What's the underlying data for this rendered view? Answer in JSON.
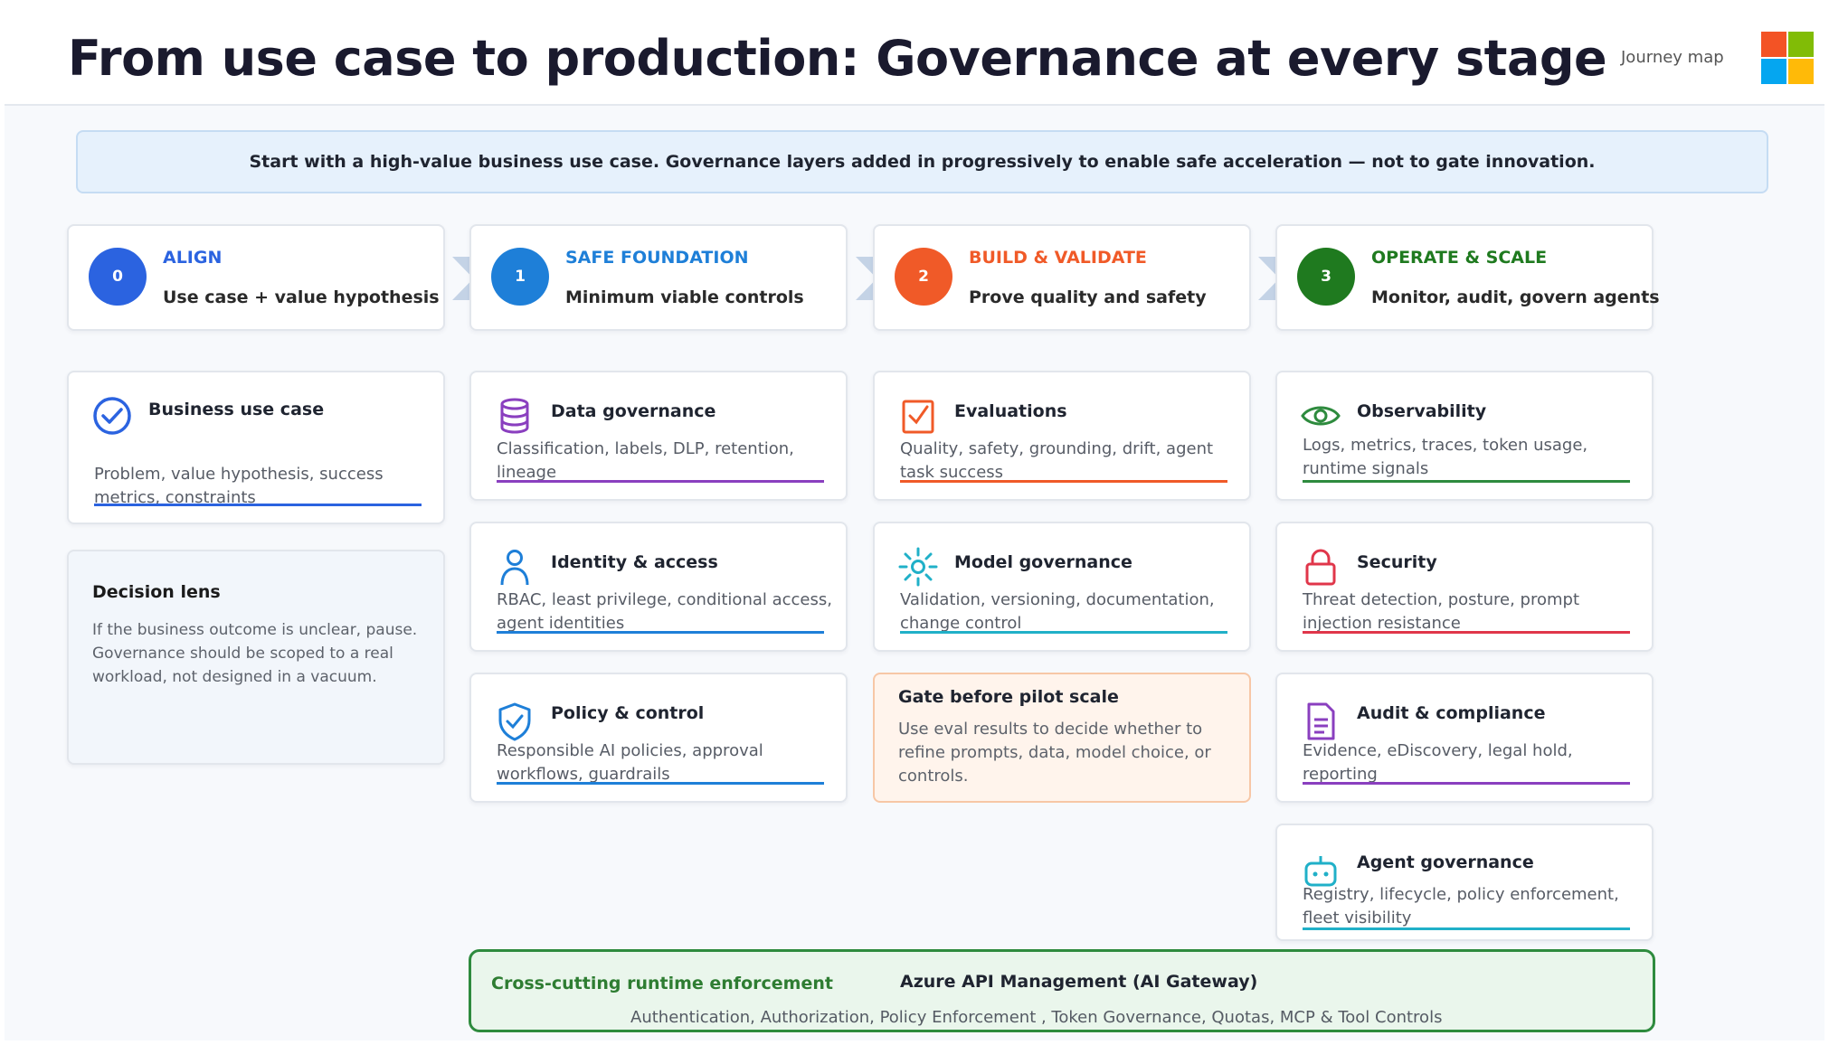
{
  "header": {
    "title": "From use case to production: Governance at every stage",
    "kicker": "Journey map"
  },
  "banner": "Start with a high-value business use case. Governance layers added in progressively to enable safe acceleration — not to gate innovation.",
  "stages": [
    {
      "number": "0",
      "name": "ALIGN",
      "description": "Use case + value hypothesis",
      "color": "#2b63e0"
    },
    {
      "number": "1",
      "name": "SAFE FOUNDATION",
      "description": "Minimum viable controls",
      "color": "#1e7fd8"
    },
    {
      "number": "2",
      "name": "BUILD & VALIDATE",
      "description": "Prove quality and safety",
      "color": "#f05a28"
    },
    {
      "number": "3",
      "name": "OPERATE & SCALE",
      "description": "Monitor, audit, govern agents",
      "color": "#1f7a1f"
    }
  ],
  "align_column": {
    "business_use_case": {
      "title": "Business use case",
      "description": "Problem, value hypothesis, success metrics, constraints",
      "icon": "check-circle-icon",
      "accent": "#2b63e0"
    },
    "decision_lens": {
      "title": "Decision lens",
      "description": "If the business outcome is unclear, pause. Governance should be scoped to a real workload, not designed in a vacuum."
    }
  },
  "foundation_column": [
    {
      "title": "Data governance",
      "description": "Classification, labels, DLP, retention, lineage",
      "icon": "database-icon",
      "accent": "#8a3fbf"
    },
    {
      "title": "Identity & access",
      "description": "RBAC, least privilege, conditional access, agent identities",
      "icon": "person-icon",
      "accent": "#1e7fd8"
    },
    {
      "title": "Policy & control",
      "description": "Responsible AI policies, approval workflows, guardrails",
      "icon": "shield-check-icon",
      "accent": "#1e7fd8"
    }
  ],
  "build_column": [
    {
      "title": "Evaluations",
      "description": "Quality, safety, grounding, drift, agent task success",
      "icon": "checklist-icon",
      "accent": "#f05a28"
    },
    {
      "title": "Model governance",
      "description": "Validation, versioning, documentation, change control",
      "icon": "model-sun-icon",
      "accent": "#20b0c8"
    }
  ],
  "gate": {
    "title": "Gate before pilot scale",
    "description": "Use eval results to decide whether to refine prompts, data, model choice, or controls."
  },
  "operate_column": [
    {
      "title": "Observability",
      "description": "Logs, metrics, traces, token usage, runtime signals",
      "icon": "eye-icon",
      "accent": "#2e8b3e"
    },
    {
      "title": "Security",
      "description": "Threat detection, posture, prompt injection resistance",
      "icon": "lock-icon",
      "accent": "#e0364a"
    },
    {
      "title": "Audit & compliance",
      "description": "Evidence, eDiscovery, legal hold, reporting",
      "icon": "document-icon",
      "accent": "#8a3fbf"
    },
    {
      "title": "Agent governance",
      "description": "Registry, lifecycle, policy enforcement, fleet visibility",
      "icon": "robot-icon",
      "accent": "#20b0c8"
    }
  ],
  "runtime": {
    "label": "Cross-cutting runtime enforcement",
    "title": "Azure API Management (AI Gateway)",
    "description": "Authentication, Authorization, Policy Enforcement , Token Governance, Quotas, MCP & Tool Controls"
  }
}
